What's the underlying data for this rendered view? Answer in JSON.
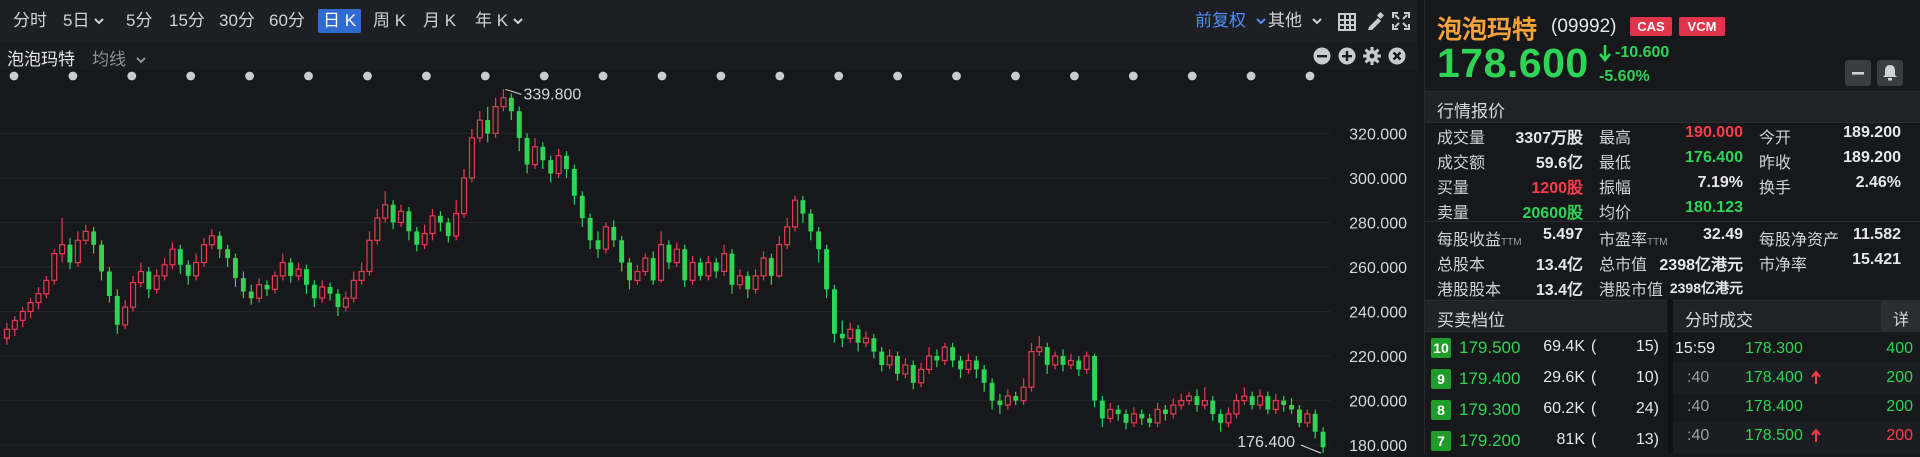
{
  "toolbar": {
    "periods": [
      {
        "label": "分时",
        "caret": false
      },
      {
        "label": "5日",
        "caret": true
      },
      {
        "label": "5分",
        "caret": false
      },
      {
        "label": "15分",
        "caret": false
      },
      {
        "label": "30分",
        "caret": false
      },
      {
        "label": "60分",
        "caret": false
      },
      {
        "label": "日 K",
        "caret": false,
        "active": true
      },
      {
        "label": "周 K",
        "caret": false
      },
      {
        "label": "月 K",
        "caret": false
      },
      {
        "label": "年 K",
        "caret": true
      }
    ],
    "adjust_label": "前复权",
    "other_label": "其他"
  },
  "subbar": {
    "stock_name": "泡泡玛特",
    "ma_label": "均线"
  },
  "colors": {
    "up": "#e83a4f",
    "down": "#2fd455",
    "accent": "#4f8ef7",
    "bg": "#17181c"
  },
  "chart_data": {
    "type": "candlestick",
    "y_ticks": [
      320,
      300,
      280,
      260,
      240,
      220,
      200,
      180
    ],
    "y_tick_labels": [
      "320.000",
      "300.000",
      "280.000",
      "260.000",
      "240.000",
      "220.000",
      "200.000",
      "180.000"
    ],
    "ylim": [
      176,
      344
    ],
    "grid": true,
    "high_label": "339.800",
    "low_label": "176.400",
    "high_value": 339.8,
    "low_value": 176.4,
    "event_dot_count": 23,
    "candles": [
      [
        228,
        232,
        225,
        235
      ],
      [
        232,
        236,
        229,
        238
      ],
      [
        236,
        240,
        233,
        242
      ],
      [
        240,
        244,
        237,
        246
      ],
      [
        244,
        248,
        241,
        251
      ],
      [
        248,
        254,
        246,
        256
      ],
      [
        254,
        266,
        252,
        268
      ],
      [
        266,
        270,
        262,
        282
      ],
      [
        270,
        262,
        259,
        273
      ],
      [
        262,
        272,
        260,
        276
      ],
      [
        272,
        276,
        270,
        279
      ],
      [
        276,
        270,
        266,
        278
      ],
      [
        270,
        258,
        254,
        272
      ],
      [
        258,
        247,
        244,
        260
      ],
      [
        247,
        234,
        230,
        250
      ],
      [
        234,
        242,
        232,
        245
      ],
      [
        242,
        253,
        240,
        256
      ],
      [
        253,
        258,
        251,
        262
      ],
      [
        258,
        250,
        246,
        260
      ],
      [
        250,
        256,
        248,
        259
      ],
      [
        256,
        261,
        254,
        264
      ],
      [
        261,
        268,
        259,
        271
      ],
      [
        268,
        261,
        257,
        270
      ],
      [
        261,
        256,
        252,
        263
      ],
      [
        256,
        262,
        254,
        266
      ],
      [
        262,
        270,
        260,
        273
      ],
      [
        270,
        274,
        268,
        277
      ],
      [
        274,
        268,
        264,
        276
      ],
      [
        268,
        264,
        260,
        270
      ],
      [
        264,
        255,
        251,
        266
      ],
      [
        255,
        249,
        246,
        258
      ],
      [
        249,
        246,
        243,
        252
      ],
      [
        246,
        252,
        244,
        255
      ],
      [
        252,
        250,
        247,
        254
      ],
      [
        250,
        256,
        248,
        258
      ],
      [
        256,
        262,
        254,
        266
      ],
      [
        262,
        256,
        253,
        264
      ],
      [
        256,
        259,
        254,
        262
      ],
      [
        259,
        252,
        248,
        261
      ],
      [
        252,
        246,
        242,
        254
      ],
      [
        246,
        251,
        244,
        254
      ],
      [
        251,
        248,
        245,
        253
      ],
      [
        248,
        242,
        238,
        250
      ],
      [
        242,
        246,
        240,
        249
      ],
      [
        246,
        254,
        244,
        258
      ],
      [
        254,
        258,
        252,
        262
      ],
      [
        258,
        272,
        256,
        276
      ],
      [
        272,
        282,
        270,
        286
      ],
      [
        282,
        288,
        280,
        294
      ],
      [
        288,
        280,
        277,
        290
      ],
      [
        280,
        285,
        278,
        288
      ],
      [
        285,
        276,
        272,
        287
      ],
      [
        276,
        270,
        267,
        278
      ],
      [
        270,
        275,
        268,
        279
      ],
      [
        275,
        283,
        272,
        286
      ],
      [
        283,
        280,
        276,
        285
      ],
      [
        280,
        274,
        271,
        282
      ],
      [
        274,
        284,
        272,
        290
      ],
      [
        284,
        300,
        282,
        304
      ],
      [
        300,
        318,
        298,
        322
      ],
      [
        318,
        326,
        316,
        330
      ],
      [
        326,
        320,
        316,
        332
      ],
      [
        320,
        332,
        318,
        336
      ],
      [
        332,
        336,
        330,
        339.8
      ],
      [
        336,
        330,
        326,
        338
      ],
      [
        330,
        318,
        312,
        332
      ],
      [
        318,
        306,
        302,
        320
      ],
      [
        306,
        314,
        304,
        318
      ],
      [
        314,
        308,
        304,
        316
      ],
      [
        308,
        302,
        298,
        310
      ],
      [
        302,
        310,
        300,
        313
      ],
      [
        310,
        304,
        300,
        312
      ],
      [
        304,
        292,
        288,
        306
      ],
      [
        292,
        282,
        278,
        294
      ],
      [
        282,
        272,
        268,
        284
      ],
      [
        272,
        268,
        264,
        276
      ],
      [
        268,
        278,
        266,
        280
      ],
      [
        278,
        272,
        269,
        281
      ],
      [
        272,
        262,
        258,
        274
      ],
      [
        262,
        254,
        250,
        264
      ],
      [
        254,
        258,
        252,
        261
      ],
      [
        258,
        264,
        256,
        266
      ],
      [
        264,
        254,
        252,
        267
      ],
      [
        254,
        270,
        253,
        276
      ],
      [
        270,
        262,
        259,
        272
      ],
      [
        262,
        268,
        260,
        271
      ],
      [
        268,
        254,
        251,
        270
      ],
      [
        254,
        262,
        252,
        265
      ],
      [
        262,
        256,
        254,
        264
      ],
      [
        256,
        262,
        254,
        265
      ],
      [
        262,
        258,
        255,
        264
      ],
      [
        258,
        266,
        256,
        270
      ],
      [
        266,
        252,
        248,
        268
      ],
      [
        252,
        256,
        250,
        259
      ],
      [
        256,
        250,
        246,
        258
      ],
      [
        250,
        256,
        248,
        259
      ],
      [
        256,
        264,
        254,
        267
      ],
      [
        264,
        256,
        252,
        266
      ],
      [
        256,
        270,
        255,
        274
      ],
      [
        270,
        278,
        268,
        282
      ],
      [
        278,
        290,
        276,
        292
      ],
      [
        290,
        284,
        280,
        292
      ],
      [
        284,
        276,
        272,
        286
      ],
      [
        276,
        268,
        262,
        278
      ],
      [
        268,
        250,
        246,
        270
      ],
      [
        250,
        230,
        226,
        252
      ],
      [
        230,
        228,
        224,
        236
      ],
      [
        228,
        232,
        226,
        235
      ],
      [
        232,
        226,
        222,
        234
      ],
      [
        226,
        228,
        224,
        231
      ],
      [
        228,
        222,
        219,
        230
      ],
      [
        222,
        216,
        213,
        224
      ],
      [
        216,
        220,
        214,
        223
      ],
      [
        220,
        212,
        209,
        222
      ],
      [
        212,
        216,
        210,
        219
      ],
      [
        216,
        208,
        205,
        218
      ],
      [
        208,
        214,
        206,
        217
      ],
      [
        214,
        220,
        212,
        224
      ],
      [
        220,
        218,
        215,
        223
      ],
      [
        218,
        224,
        216,
        226
      ],
      [
        224,
        218,
        215,
        226
      ],
      [
        218,
        214,
        210,
        220
      ],
      [
        214,
        218,
        212,
        221
      ],
      [
        218,
        214,
        210,
        220
      ],
      [
        214,
        208,
        204,
        216
      ],
      [
        208,
        200,
        196,
        210
      ],
      [
        200,
        198,
        194,
        203
      ],
      [
        198,
        202,
        196,
        205
      ],
      [
        202,
        200,
        198,
        204
      ],
      [
        200,
        206,
        198,
        210
      ],
      [
        206,
        222,
        204,
        226
      ],
      [
        222,
        224,
        220,
        229
      ],
      [
        224,
        216,
        212,
        226
      ],
      [
        216,
        220,
        214,
        222
      ],
      [
        220,
        216,
        213,
        223
      ],
      [
        216,
        218,
        214,
        221
      ],
      [
        218,
        214,
        211,
        220
      ],
      [
        214,
        220,
        212,
        222
      ],
      [
        220,
        200,
        197,
        221
      ],
      [
        200,
        192,
        188,
        202
      ],
      [
        192,
        196,
        190,
        199
      ],
      [
        196,
        194,
        191,
        198
      ],
      [
        194,
        190,
        187,
        196
      ],
      [
        190,
        194,
        188,
        197
      ],
      [
        194,
        192,
        189,
        196
      ],
      [
        192,
        190,
        188,
        194
      ],
      [
        190,
        196,
        188,
        199
      ],
      [
        196,
        194,
        191,
        198
      ],
      [
        194,
        198,
        192,
        201
      ],
      [
        198,
        200,
        196,
        203
      ],
      [
        200,
        202,
        198,
        204
      ],
      [
        202,
        198,
        195,
        205
      ],
      [
        198,
        200,
        196,
        206
      ],
      [
        200,
        194,
        191,
        202
      ],
      [
        194,
        190,
        186,
        196
      ],
      [
        190,
        194,
        188,
        197
      ],
      [
        194,
        200,
        192,
        203
      ],
      [
        200,
        202,
        198,
        206
      ],
      [
        202,
        198,
        196,
        204
      ],
      [
        198,
        202,
        196,
        205
      ],
      [
        202,
        196,
        194,
        204
      ],
      [
        196,
        200,
        194,
        203
      ],
      [
        200,
        198,
        195,
        202
      ],
      [
        198,
        196,
        194,
        201
      ],
      [
        196,
        190,
        188,
        198
      ],
      [
        190,
        194,
        188,
        196
      ],
      [
        194,
        186,
        183,
        196
      ],
      [
        186,
        179,
        176.4,
        188
      ]
    ]
  },
  "quote": {
    "name": "泡泡玛特",
    "code": "(09992)",
    "badges": [
      "CAS",
      "VCM"
    ],
    "price": "178.600",
    "change": "-10.600",
    "change_pct": "-5.60%",
    "section_title": "行情报价",
    "rows": [
      {
        "l1": "成交量",
        "v1": "3307万股",
        "c1": "#e6e7ea",
        "l2": "最高",
        "v2": "190.000",
        "c2": "#ff3b4b",
        "l3": "今开",
        "v3": "189.200",
        "c3": "#e6e7ea"
      },
      {
        "l1": "成交额",
        "v1": "59.6亿",
        "c1": "#e6e7ea",
        "l2": "最低",
        "v2": "176.400",
        "c2": "#2fd455",
        "l3": "昨收",
        "v3": "189.200",
        "c3": "#e6e7ea"
      },
      {
        "l1": "买量",
        "v1": "1200股",
        "c1": "#ff3b4b",
        "l2": "振幅",
        "v2": "7.19%",
        "c2": "#e6e7ea",
        "l3": "换手",
        "v3": "2.46%",
        "c3": "#e6e7ea"
      },
      {
        "l1": "卖量",
        "v1": "20600股",
        "c1": "#2fd455",
        "l2": "均价",
        "v2": "180.123",
        "c2": "#2fd455",
        "l3": "",
        "v3": "",
        "c3": "#e6e7ea"
      }
    ],
    "rows2": [
      {
        "l1": "每股收益",
        "s1": "TTM",
        "v1": "5.497",
        "l2": "市盈率",
        "s2": "TTM",
        "v2": "32.49",
        "l3": "每股净资产",
        "v3": "11.582"
      },
      {
        "l1": "总股本",
        "s1": "",
        "v1": "13.4亿",
        "l2": "总市值",
        "s2": "",
        "v2": "2398亿港元",
        "l3": "市净率",
        "v3": "15.421"
      },
      {
        "l1": "港股股本",
        "s1": "",
        "v1": "13.4亿",
        "l2": "港股市值",
        "s2": "",
        "v2": "2398亿港元",
        "l3": "",
        "v3": ""
      }
    ]
  },
  "orderbook": {
    "title": "买卖档位",
    "levels": [
      {
        "level": "10",
        "price": "179.500",
        "vol": "69.4K",
        "cnt": "15)"
      },
      {
        "level": "9",
        "price": "179.400",
        "vol": "29.6K",
        "cnt": "10)"
      },
      {
        "level": "8",
        "price": "179.300",
        "vol": "60.2K",
        "cnt": "24)"
      },
      {
        "level": "7",
        "price": "179.200",
        "vol": "81K",
        "cnt": "13)"
      }
    ]
  },
  "ticks": {
    "title": "分时成交",
    "detail_label": "详",
    "rows": [
      {
        "time": "15:59",
        "price": "178.300",
        "arrow": "",
        "vol": "400",
        "vcolor": "#2fd455"
      },
      {
        "time": ":40",
        "price": "178.400",
        "arrow": "up",
        "vol": "200",
        "vcolor": "#2fd455"
      },
      {
        "time": ":40",
        "price": "178.400",
        "arrow": "",
        "vol": "200",
        "vcolor": "#2fd455"
      },
      {
        "time": ":40",
        "price": "178.500",
        "arrow": "up",
        "vol": "200",
        "vcolor": "#ff3b4b"
      }
    ]
  }
}
